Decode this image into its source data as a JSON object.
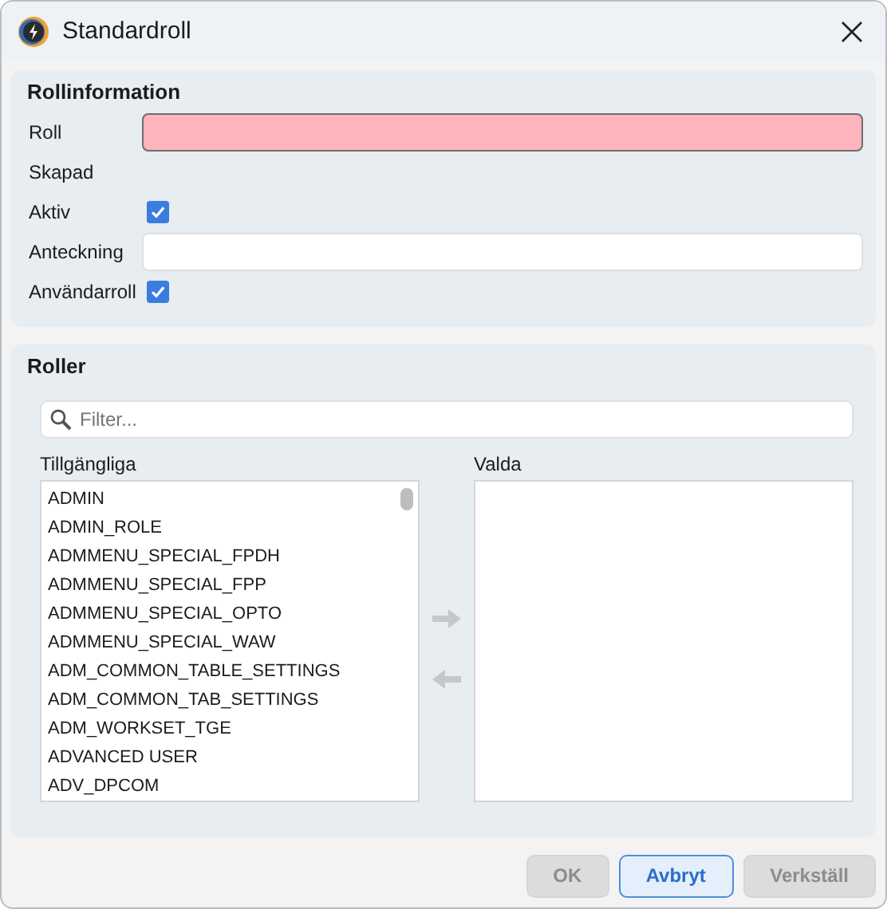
{
  "window": {
    "title": "Standardroll"
  },
  "role_info": {
    "heading": "Rollinformation",
    "fields": [
      {
        "kind": "text",
        "label": "Roll",
        "invalid": true
      },
      {
        "kind": "static",
        "label": "Skapad"
      },
      {
        "kind": "checkbox",
        "label": "Aktiv",
        "checked": true
      },
      {
        "kind": "text",
        "label": "Anteckning",
        "invalid": false
      },
      {
        "kind": "checkbox",
        "label": "Användarroll",
        "checked": true
      }
    ]
  },
  "roles": {
    "heading": "Roller",
    "filter": {
      "placeholder": "Filter..."
    },
    "available": {
      "label": "Tillgängliga",
      "items": [
        "ADMIN",
        "ADMIN_ROLE",
        "ADMMENU_SPECIAL_FPDH",
        "ADMMENU_SPECIAL_FPP",
        "ADMMENU_SPECIAL_OPTO",
        "ADMMENU_SPECIAL_WAW",
        "ADM_COMMON_TABLE_SETTINGS",
        "ADM_COMMON_TAB_SETTINGS",
        "ADM_WORKSET_TGE",
        "ADVANCED USER",
        "ADV_DPCOM"
      ]
    },
    "add_button": {
      "disabled": true
    },
    "remove_button": {
      "disabled": true
    },
    "selected": {
      "label": "Valda"
    }
  },
  "buttons": [
    {
      "label": "OK",
      "disabled": true,
      "focused": false
    },
    {
      "label": "Avbryt",
      "disabled": false,
      "focused": true
    },
    {
      "label": "Verkställ",
      "disabled": true,
      "focused": false
    }
  ]
}
